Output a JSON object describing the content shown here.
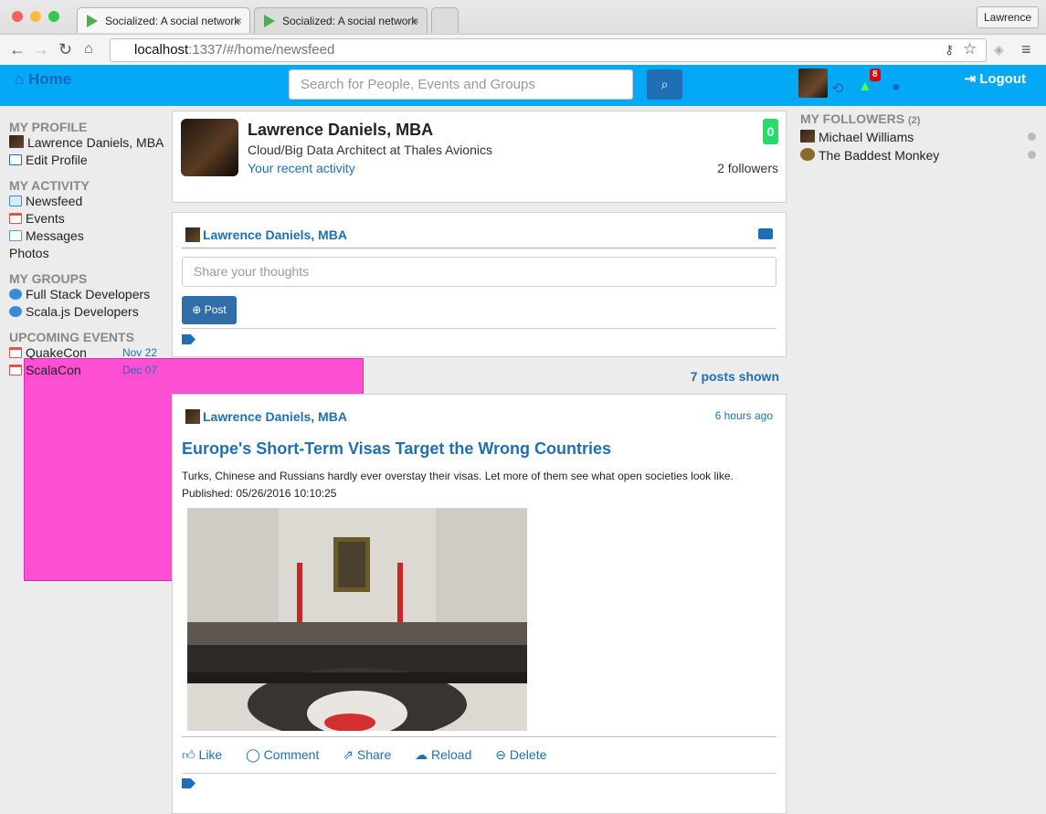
{
  "browser": {
    "tabs": [
      {
        "label": "Socialized: A social network",
        "active": true
      },
      {
        "label": "Socialized: A social network",
        "active": false
      }
    ],
    "user_button": "Lawrence",
    "url_host": "localhost",
    "url_path": ":1337/#/home/newsfeed"
  },
  "navbar": {
    "brand": "Home",
    "search_placeholder": "Search for People, Events and Groups",
    "notification_count": "8",
    "logout_label": "Logout",
    "colors": {
      "bar": "#03a9f4",
      "search_button": "#1e6fb3"
    }
  },
  "sidebar": {
    "profile_heading": "MY PROFILE",
    "profile_name": "Lawrence Daniels, MBA",
    "edit_profile": "Edit Profile",
    "activity_heading": "MY ACTIVITY",
    "activity_items": [
      "Newsfeed",
      "Events",
      "Messages",
      "Photos"
    ],
    "groups_heading": "MY GROUPS",
    "groups": [
      "Full Stack Developers",
      "Scala.js Developers"
    ],
    "events_heading": "UPCOMING EVENTS",
    "events": [
      {
        "name": "QuakeCon",
        "date": "Nov 22"
      },
      {
        "name": "ScalaCon",
        "date": "Dec 07"
      }
    ]
  },
  "profile_card": {
    "name": "Lawrence Daniels, MBA",
    "title": "Cloud/Big Data Architect at Thales Avionics",
    "activity_link": "Your recent activity",
    "score": "0",
    "followers": "2 followers"
  },
  "compose": {
    "author": "Lawrence Daniels, MBA",
    "placeholder": "Share your thoughts",
    "post_button": "Post"
  },
  "feed": {
    "posts_shown": "7 posts shown"
  },
  "post": {
    "author": "Lawrence Daniels, MBA",
    "time": "6 hours ago",
    "headline": "Europe's Short-Term Visas Target the Wrong Countries",
    "summary": "Turks, Chinese and Russians hardly ever overstay their visas. Let more of them see what open societies look like.",
    "published": "Published: 05/26/2016 10:10:25",
    "actions": [
      "Like",
      "Comment",
      "Share",
      "Reload",
      "Delete"
    ]
  },
  "followers": {
    "heading": "MY FOLLOWERS",
    "count": "(2)",
    "items": [
      "Michael Williams",
      "The Baddest Monkey"
    ]
  }
}
